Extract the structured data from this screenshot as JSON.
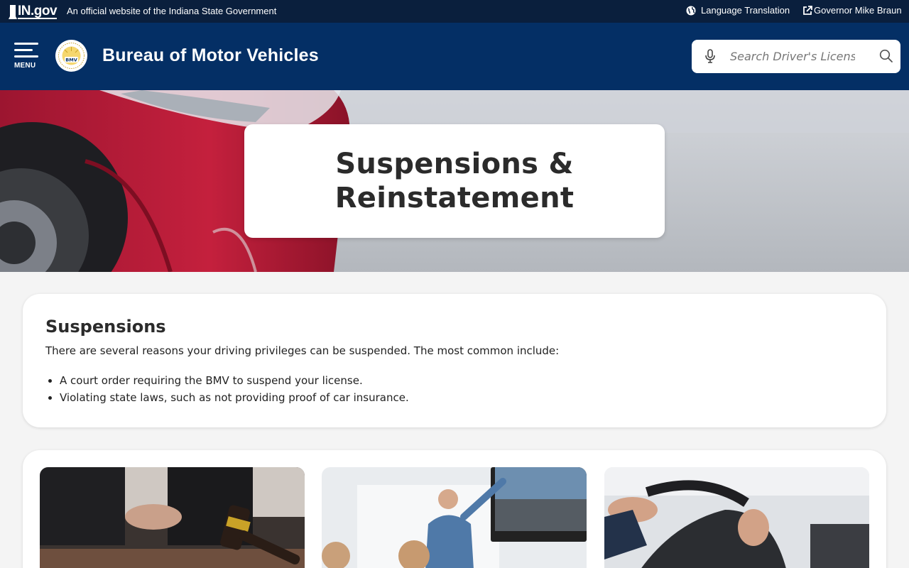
{
  "govbar": {
    "logo_text": "IN.gov",
    "official_text": "An official website of the Indiana State Government",
    "language_label": "Language Translation",
    "governor_label": "Governor Mike Braun"
  },
  "header": {
    "menu_label": "MENU",
    "seal_text": "BMV",
    "title": "Bureau of Motor Vehicles",
    "search_placeholder": "Search Driver's License:"
  },
  "hero": {
    "title": "Suspensions & Reinstatement"
  },
  "suspensions": {
    "heading": "Suspensions",
    "intro": "There are several reasons your driving privileges can be suspended. The most common include:",
    "items": [
      "A court order requiring the BMV to suspend your license.",
      "Violating state laws, such as not providing proof of car insurance."
    ]
  },
  "colors": {
    "gov_bar": "#0a1f3d",
    "header": "#042f65",
    "page_bg": "#f4f4f4"
  }
}
